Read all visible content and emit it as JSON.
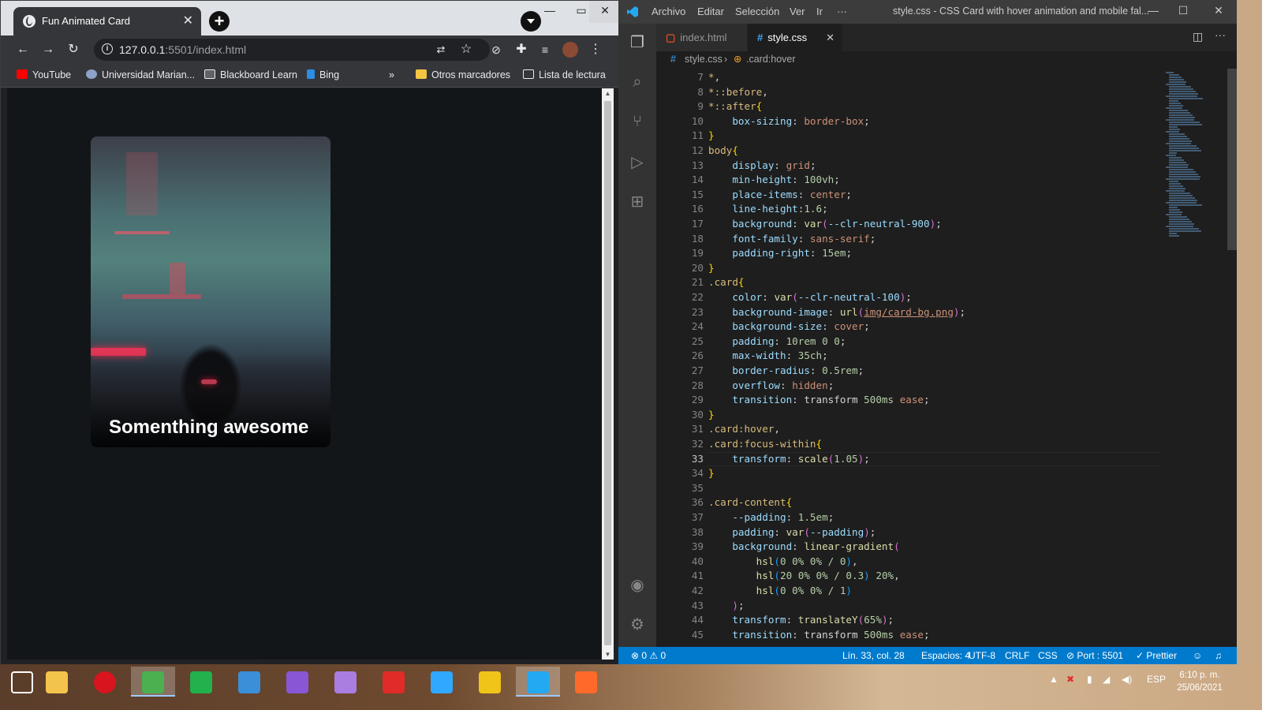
{
  "chrome": {
    "tab_title": "Fun Animated Card",
    "url_host": "127.0.0.1",
    "url_rest": ":5501/index.html",
    "bookmarks": [
      {
        "label": "YouTube",
        "icon": "youtube-icon",
        "color": "#ff0000"
      },
      {
        "label": "Universidad Marian...",
        "icon": "university-icon",
        "color": "#8da2c8"
      },
      {
        "label": "Blackboard Learn",
        "icon": "blackboard-icon",
        "color": "#e8eaed"
      },
      {
        "label": "Bing",
        "icon": "bing-icon",
        "color": "#2b8ee6"
      }
    ],
    "more_bookmarks": "»",
    "other_bookmarks": "Otros marcadores",
    "reading_list": "Lista de lectura",
    "card_title": "Somenthing awesome",
    "page_bg": "#131619"
  },
  "vscode": {
    "menu": [
      "Archivo",
      "Editar",
      "Selección",
      "Ver",
      "Ir",
      "···"
    ],
    "window_title": "style.css - CSS Card with hover animation and mobile fal...",
    "tabs": [
      {
        "label": "index.html",
        "icon": "html-file-icon",
        "active": false
      },
      {
        "label": "style.css",
        "icon": "css-file-icon",
        "active": true
      }
    ],
    "breadcrumb_file": "style.css",
    "breadcrumb_symbol": ".card:hover",
    "current_line": 33,
    "code": [
      {
        "n": "7",
        "t": [
          [
            "*",
            "c-sel"
          ],
          [
            ",",
            "c-p"
          ]
        ]
      },
      {
        "n": "8",
        "t": [
          [
            "*::before",
            "c-sel"
          ],
          [
            ",",
            "c-p"
          ]
        ]
      },
      {
        "n": "9",
        "t": [
          [
            "*::after",
            "c-sel"
          ],
          [
            "{",
            "c-y"
          ]
        ]
      },
      {
        "n": "10",
        "t": [
          [
            "    ",
            "c-p"
          ],
          [
            "box-sizing",
            "c-prop"
          ],
          [
            ": ",
            "c-p"
          ],
          [
            "border-box",
            "c-val"
          ],
          [
            ";",
            "c-p"
          ]
        ]
      },
      {
        "n": "11",
        "t": [
          [
            "}",
            "c-y"
          ]
        ]
      },
      {
        "n": "12",
        "t": [
          [
            "body",
            "c-sel"
          ],
          [
            "{",
            "c-y"
          ]
        ]
      },
      {
        "n": "13",
        "t": [
          [
            "    ",
            "c-p"
          ],
          [
            "display",
            "c-prop"
          ],
          [
            ": ",
            "c-p"
          ],
          [
            "grid",
            "c-val"
          ],
          [
            ";",
            "c-p"
          ]
        ]
      },
      {
        "n": "14",
        "t": [
          [
            "    ",
            "c-p"
          ],
          [
            "min-height",
            "c-prop"
          ],
          [
            ": ",
            "c-p"
          ],
          [
            "100vh",
            "c-num"
          ],
          [
            ";",
            "c-p"
          ]
        ]
      },
      {
        "n": "15",
        "t": [
          [
            "    ",
            "c-p"
          ],
          [
            "place-items",
            "c-prop"
          ],
          [
            ": ",
            "c-p"
          ],
          [
            "center",
            "c-val"
          ],
          [
            ";",
            "c-p"
          ]
        ]
      },
      {
        "n": "16",
        "t": [
          [
            "    ",
            "c-p"
          ],
          [
            "line-height",
            "c-prop"
          ],
          [
            ":",
            "c-p"
          ],
          [
            "1.6",
            "c-num"
          ],
          [
            ";",
            "c-p"
          ]
        ]
      },
      {
        "n": "17",
        "t": [
          [
            "    ",
            "c-p"
          ],
          [
            "background",
            "c-prop"
          ],
          [
            ": ",
            "c-p"
          ],
          [
            "var",
            "c-fn"
          ],
          [
            "(",
            "c-pk"
          ],
          [
            "--clr-neutral-900",
            "c-prop"
          ],
          [
            ")",
            "c-pk"
          ],
          [
            ";",
            "c-p"
          ]
        ]
      },
      {
        "n": "18",
        "t": [
          [
            "    ",
            "c-p"
          ],
          [
            "font-family",
            "c-prop"
          ],
          [
            ": ",
            "c-p"
          ],
          [
            "sans-serif",
            "c-val"
          ],
          [
            ";",
            "c-p"
          ]
        ]
      },
      {
        "n": "19",
        "t": [
          [
            "    ",
            "c-p"
          ],
          [
            "padding-right",
            "c-prop"
          ],
          [
            ": ",
            "c-p"
          ],
          [
            "15em",
            "c-num"
          ],
          [
            ";",
            "c-p"
          ]
        ]
      },
      {
        "n": "20",
        "t": [
          [
            "}",
            "c-y"
          ]
        ]
      },
      {
        "n": "21",
        "t": [
          [
            ".card",
            "c-sel"
          ],
          [
            "{",
            "c-y"
          ]
        ]
      },
      {
        "n": "22",
        "t": [
          [
            "    ",
            "c-p"
          ],
          [
            "color",
            "c-prop"
          ],
          [
            ": ",
            "c-p"
          ],
          [
            "var",
            "c-fn"
          ],
          [
            "(",
            "c-pk"
          ],
          [
            "--clr-neutral-100",
            "c-prop"
          ],
          [
            ")",
            "c-pk"
          ],
          [
            ";",
            "c-p"
          ]
        ]
      },
      {
        "n": "23",
        "t": [
          [
            "    ",
            "c-p"
          ],
          [
            "background-image",
            "c-prop"
          ],
          [
            ": ",
            "c-p"
          ],
          [
            "url",
            "c-fn"
          ],
          [
            "(",
            "c-pk"
          ],
          [
            "img/card-bg.png",
            "c-link"
          ],
          [
            ")",
            "c-pk"
          ],
          [
            ";",
            "c-p"
          ]
        ]
      },
      {
        "n": "24",
        "t": [
          [
            "    ",
            "c-p"
          ],
          [
            "background-size",
            "c-prop"
          ],
          [
            ": ",
            "c-p"
          ],
          [
            "cover",
            "c-val"
          ],
          [
            ";",
            "c-p"
          ]
        ]
      },
      {
        "n": "25",
        "t": [
          [
            "    ",
            "c-p"
          ],
          [
            "padding",
            "c-prop"
          ],
          [
            ": ",
            "c-p"
          ],
          [
            "10rem 0 0",
            "c-num"
          ],
          [
            ";",
            "c-p"
          ]
        ]
      },
      {
        "n": "26",
        "t": [
          [
            "    ",
            "c-p"
          ],
          [
            "max-width",
            "c-prop"
          ],
          [
            ": ",
            "c-p"
          ],
          [
            "35ch",
            "c-num"
          ],
          [
            ";",
            "c-p"
          ]
        ]
      },
      {
        "n": "27",
        "t": [
          [
            "    ",
            "c-p"
          ],
          [
            "border-radius",
            "c-prop"
          ],
          [
            ": ",
            "c-p"
          ],
          [
            "0.5rem",
            "c-num"
          ],
          [
            ";",
            "c-p"
          ]
        ]
      },
      {
        "n": "28",
        "t": [
          [
            "    ",
            "c-p"
          ],
          [
            "overflow",
            "c-prop"
          ],
          [
            ": ",
            "c-p"
          ],
          [
            "hidden",
            "c-val"
          ],
          [
            ";",
            "c-p"
          ]
        ]
      },
      {
        "n": "29",
        "t": [
          [
            "    ",
            "c-p"
          ],
          [
            "transition",
            "c-prop"
          ],
          [
            ": ",
            "c-p"
          ],
          [
            "transform ",
            "c-p"
          ],
          [
            "500ms",
            "c-num"
          ],
          [
            " ",
            "c-p"
          ],
          [
            "ease",
            "c-val"
          ],
          [
            ";",
            "c-p"
          ]
        ]
      },
      {
        "n": "30",
        "t": [
          [
            "}",
            "c-y"
          ]
        ]
      },
      {
        "n": "31",
        "t": [
          [
            ".card:hover",
            "c-sel"
          ],
          [
            ",",
            "c-p"
          ]
        ]
      },
      {
        "n": "32",
        "t": [
          [
            ".card:focus-within",
            "c-sel"
          ],
          [
            "{",
            "c-y"
          ]
        ]
      },
      {
        "n": "33",
        "t": [
          [
            "    ",
            "c-p"
          ],
          [
            "transform",
            "c-prop"
          ],
          [
            ": ",
            "c-p"
          ],
          [
            "scale",
            "c-fn"
          ],
          [
            "(",
            "c-pk"
          ],
          [
            "1.05",
            "c-num"
          ],
          [
            ")",
            "c-pk"
          ],
          [
            ";",
            "c-p"
          ]
        ]
      },
      {
        "n": "34",
        "t": [
          [
            "}",
            "c-y"
          ]
        ]
      },
      {
        "n": "35",
        "t": []
      },
      {
        "n": "36",
        "t": [
          [
            ".card-content",
            "c-sel"
          ],
          [
            "{",
            "c-y"
          ]
        ]
      },
      {
        "n": "37",
        "t": [
          [
            "    ",
            "c-p"
          ],
          [
            "--padding",
            "c-prop"
          ],
          [
            ": ",
            "c-p"
          ],
          [
            "1.5em",
            "c-num"
          ],
          [
            ";",
            "c-p"
          ]
        ]
      },
      {
        "n": "38",
        "t": [
          [
            "    ",
            "c-p"
          ],
          [
            "padding",
            "c-prop"
          ],
          [
            ": ",
            "c-p"
          ],
          [
            "var",
            "c-fn"
          ],
          [
            "(",
            "c-pk"
          ],
          [
            "--padding",
            "c-prop"
          ],
          [
            ")",
            "c-pk"
          ],
          [
            ";",
            "c-p"
          ]
        ]
      },
      {
        "n": "39",
        "t": [
          [
            "    ",
            "c-p"
          ],
          [
            "background",
            "c-prop"
          ],
          [
            ": ",
            "c-p"
          ],
          [
            "linear-gradient",
            "c-fn"
          ],
          [
            "(",
            "c-pk"
          ]
        ]
      },
      {
        "n": "40",
        "t": [
          [
            "        ",
            "c-p"
          ],
          [
            "hsl",
            "c-fn"
          ],
          [
            "(",
            "c-b"
          ],
          [
            "0 0% 0% / 0",
            "c-num"
          ],
          [
            ")",
            "c-b"
          ],
          [
            ",",
            "c-p"
          ]
        ]
      },
      {
        "n": "41",
        "t": [
          [
            "        ",
            "c-p"
          ],
          [
            "hsl",
            "c-fn"
          ],
          [
            "(",
            "c-b"
          ],
          [
            "20 0% 0% / 0.3",
            "c-num"
          ],
          [
            ")",
            "c-b"
          ],
          [
            " ",
            "c-p"
          ],
          [
            "20%",
            "c-num"
          ],
          [
            ",",
            "c-p"
          ]
        ]
      },
      {
        "n": "42",
        "t": [
          [
            "        ",
            "c-p"
          ],
          [
            "hsl",
            "c-fn"
          ],
          [
            "(",
            "c-b"
          ],
          [
            "0 0% 0% / 1",
            "c-num"
          ],
          [
            ")",
            "c-b"
          ]
        ]
      },
      {
        "n": "43",
        "t": [
          [
            "    ",
            "c-p"
          ],
          [
            ")",
            "c-pk"
          ],
          [
            ";",
            "c-p"
          ]
        ]
      },
      {
        "n": "44",
        "t": [
          [
            "    ",
            "c-p"
          ],
          [
            "transform",
            "c-prop"
          ],
          [
            ": ",
            "c-p"
          ],
          [
            "translateY",
            "c-fn"
          ],
          [
            "(",
            "c-pk"
          ],
          [
            "65%",
            "c-num"
          ],
          [
            ")",
            "c-pk"
          ],
          [
            ";",
            "c-p"
          ]
        ]
      },
      {
        "n": "45",
        "t": [
          [
            "    ",
            "c-p"
          ],
          [
            "transition",
            "c-prop"
          ],
          [
            ": ",
            "c-p"
          ],
          [
            "transform ",
            "c-p"
          ],
          [
            "500ms",
            "c-num"
          ],
          [
            " ",
            "c-p"
          ],
          [
            "ease",
            "c-val"
          ],
          [
            ";",
            "c-p"
          ]
        ]
      }
    ],
    "status": {
      "problems": "⊗ 0 ⚠ 0",
      "position": "Lín. 33, col. 28",
      "spaces": "Espacios: 4",
      "encoding": "UTF-8",
      "eol": "CRLF",
      "language": "CSS",
      "port": "⊘ Port : 5501",
      "prettier": "✓ Prettier"
    }
  },
  "taskbar": {
    "apps": [
      {
        "icon": "windows-start-icon",
        "color": "#ffffff"
      },
      {
        "icon": "file-explorer-icon",
        "color": "#f3c44b"
      },
      {
        "icon": "opera-icon",
        "color": "#d8141f"
      },
      {
        "icon": "chrome-icon",
        "color": "#4caf50"
      },
      {
        "icon": "flathub-icon",
        "color": "#22b14c"
      },
      {
        "icon": "edge-circle-icon",
        "color": "#3a8fd8"
      },
      {
        "icon": "visual-studio-icon",
        "color": "#8957d5"
      },
      {
        "icon": "visual-studio-preview-icon",
        "color": "#a97ee0"
      },
      {
        "icon": "sketchup-icon",
        "color": "#e02b28"
      },
      {
        "icon": "photoshop-icon",
        "color": "#31a8ff"
      },
      {
        "icon": "lens-icon",
        "color": "#f0c419"
      },
      {
        "icon": "vscode-icon",
        "color": "#23a9f2"
      },
      {
        "icon": "brush-app-icon",
        "color": "#ff6a2a"
      }
    ],
    "language": "ESP",
    "time": "6:10 p. m.",
    "date": "25/06/2021"
  }
}
